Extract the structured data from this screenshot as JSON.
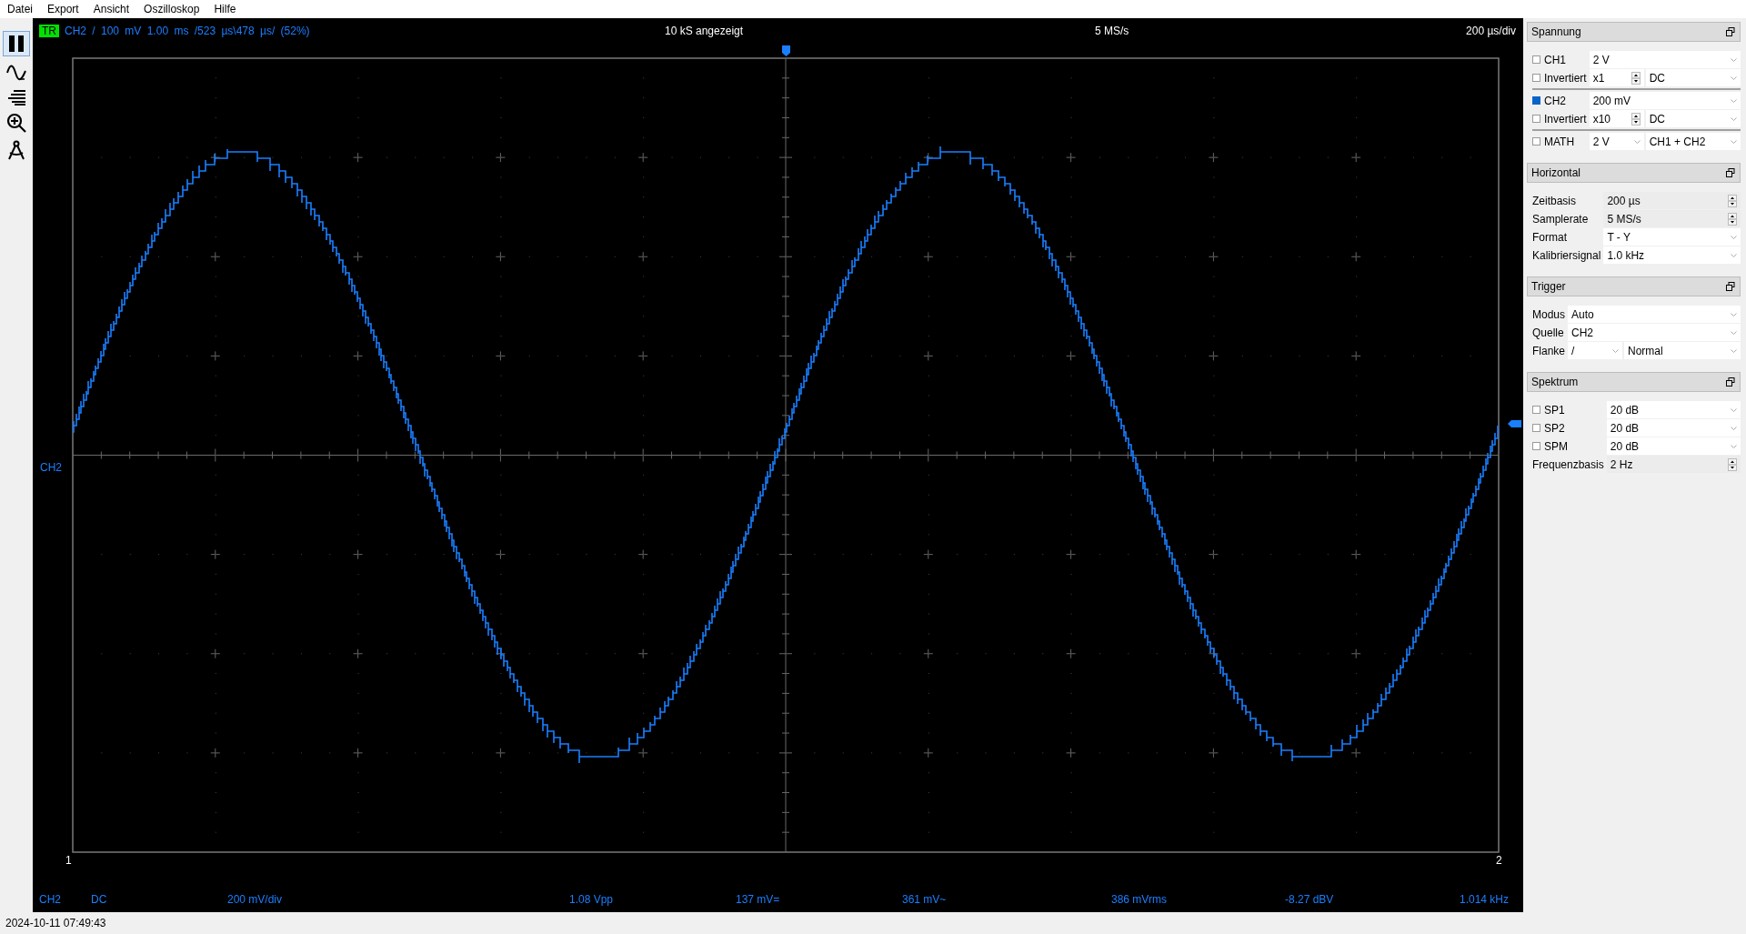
{
  "menu": [
    {
      "label": "Datei"
    },
    {
      "label": "Export"
    },
    {
      "label": "Ansicht"
    },
    {
      "label": "Oszilloskop"
    },
    {
      "label": "Hilfe"
    }
  ],
  "scope": {
    "trigger_badge": "TR",
    "trigger_info": "CH2 / 100 mV 1.00 ms /523 µs\\478 µs/ (52%)",
    "samples": "10 kS angezeigt",
    "samplerate": "5 MS/s",
    "timebase": "200 µs/div",
    "channel_label": "CH2",
    "cursor_labels": [
      "1",
      "2"
    ],
    "readouts": [
      "CH2",
      "DC",
      "200 mV/div",
      "1.08 Vpp",
      "137 mV=",
      "361 mV~",
      "386 mVrms",
      "-8.27 dBV",
      "1.014 kHz"
    ]
  },
  "panels": [
    {
      "title": "Spannung",
      "groups": [
        [
          {
            "kind": "check",
            "label": "CH1",
            "checked": false,
            "controls": [
              {
                "kind": "dropdown",
                "value": "2 V"
              }
            ]
          },
          {
            "kind": "check",
            "label": "Invertiert",
            "checked": false,
            "controls": [
              {
                "kind": "spinner",
                "value": "x1"
              },
              {
                "kind": "dropdown",
                "value": "DC"
              }
            ]
          }
        ],
        [
          {
            "kind": "check",
            "label": "CH2",
            "checked": true,
            "controls": [
              {
                "kind": "dropdown",
                "value": "200 mV"
              }
            ]
          },
          {
            "kind": "check",
            "label": "Invertiert",
            "checked": false,
            "controls": [
              {
                "kind": "spinner",
                "value": "x10"
              },
              {
                "kind": "dropdown",
                "value": "DC"
              }
            ]
          }
        ],
        [
          {
            "kind": "check",
            "label": "MATH",
            "checked": false,
            "controls": [
              {
                "kind": "dropdown",
                "value": "2 V"
              },
              {
                "kind": "dropdown",
                "value": "CH1 + CH2"
              }
            ]
          }
        ]
      ]
    },
    {
      "title": "Horizontal",
      "groups": [
        [
          {
            "kind": "plain",
            "label": "Zeitbasis",
            "controls": [
              {
                "kind": "stepper",
                "value": "200 µs"
              }
            ]
          },
          {
            "kind": "plain",
            "label": "Samplerate",
            "controls": [
              {
                "kind": "stepper",
                "value": "5 MS/s"
              }
            ]
          },
          {
            "kind": "plain",
            "label": "Format",
            "controls": [
              {
                "kind": "dropdown",
                "value": "T - Y"
              }
            ]
          },
          {
            "kind": "plain",
            "label": "Kalibriersignal",
            "controls": [
              {
                "kind": "dropdown",
                "value": "1.0 kHz"
              }
            ]
          }
        ]
      ]
    },
    {
      "title": "Trigger",
      "groups": [
        [
          {
            "kind": "plain",
            "label": "Modus",
            "controls": [
              {
                "kind": "dropdown",
                "value": "Auto"
              }
            ]
          },
          {
            "kind": "plain",
            "label": "Quelle",
            "controls": [
              {
                "kind": "dropdown",
                "value": "CH2"
              }
            ]
          },
          {
            "kind": "plain",
            "label": "Flanke",
            "controls": [
              {
                "kind": "dropdown",
                "value": "/"
              },
              {
                "kind": "dropdown",
                "value": "Normal"
              }
            ]
          }
        ]
      ]
    },
    {
      "title": "Spektrum",
      "groups": [
        [
          {
            "kind": "check",
            "label": "SP1",
            "checked": false,
            "controls": [
              {
                "kind": "dropdown",
                "value": "20 dB"
              }
            ]
          },
          {
            "kind": "check",
            "label": "SP2",
            "checked": false,
            "controls": [
              {
                "kind": "dropdown",
                "value": "20 dB"
              }
            ]
          },
          {
            "kind": "check",
            "label": "SPM",
            "checked": false,
            "controls": [
              {
                "kind": "dropdown",
                "value": "20 dB"
              }
            ]
          },
          {
            "kind": "plain",
            "label": "Frequenzbasis",
            "controls": [
              {
                "kind": "stepper",
                "value": "2 Hz"
              }
            ]
          }
        ]
      ]
    }
  ],
  "status": "2024-10-11 07:49:43"
}
